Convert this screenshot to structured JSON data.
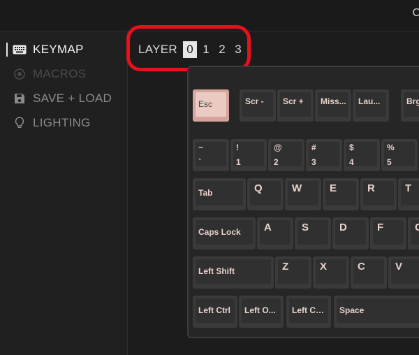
{
  "topbar": {
    "clipped_text": "C"
  },
  "sidebar": {
    "items": [
      {
        "label": "KEYMAP",
        "icon": "keyboard-icon",
        "state": "active"
      },
      {
        "label": "MACROS",
        "icon": "macro-icon",
        "state": "disabled"
      },
      {
        "label": "SAVE + LOAD",
        "icon": "save-icon",
        "state": "muted"
      },
      {
        "label": "LIGHTING",
        "icon": "lightbulb-icon",
        "state": "muted"
      }
    ]
  },
  "layer_selector": {
    "label": "LAYER",
    "layers": [
      "0",
      "1",
      "2",
      "3"
    ],
    "selected": "0",
    "highlight_color": "#e8101b"
  },
  "keyboard": {
    "rows": [
      [
        {
          "label": "Esc"
        },
        {
          "label": "Scr -"
        },
        {
          "label": "Scr +"
        },
        {
          "label": "Miss..."
        },
        {
          "label": "Lau..."
        },
        {
          "label": "Brg"
        }
      ],
      [
        {
          "label": "~\n`"
        },
        {
          "label": "!\n1"
        },
        {
          "label": "@\n2"
        },
        {
          "label": "#\n3"
        },
        {
          "label": "$\n4"
        },
        {
          "label": "%\n5"
        }
      ],
      [
        {
          "label": "Tab"
        },
        {
          "label": "Q"
        },
        {
          "label": "W"
        },
        {
          "label": "E"
        },
        {
          "label": "R"
        },
        {
          "label": "T"
        }
      ],
      [
        {
          "label": "Caps Lock"
        },
        {
          "label": "A"
        },
        {
          "label": "S"
        },
        {
          "label": "D"
        },
        {
          "label": "F"
        },
        {
          "label": "G"
        }
      ],
      [
        {
          "label": "Left Shift"
        },
        {
          "label": "Z"
        },
        {
          "label": "X"
        },
        {
          "label": "C"
        },
        {
          "label": "V"
        },
        {
          "label": ""
        }
      ],
      [
        {
          "label": "Left Ctrl"
        },
        {
          "label": "Left O..."
        },
        {
          "label": "Left Co..."
        },
        {
          "label": "Space"
        }
      ]
    ],
    "accent_key_color": "#ebcac2"
  }
}
